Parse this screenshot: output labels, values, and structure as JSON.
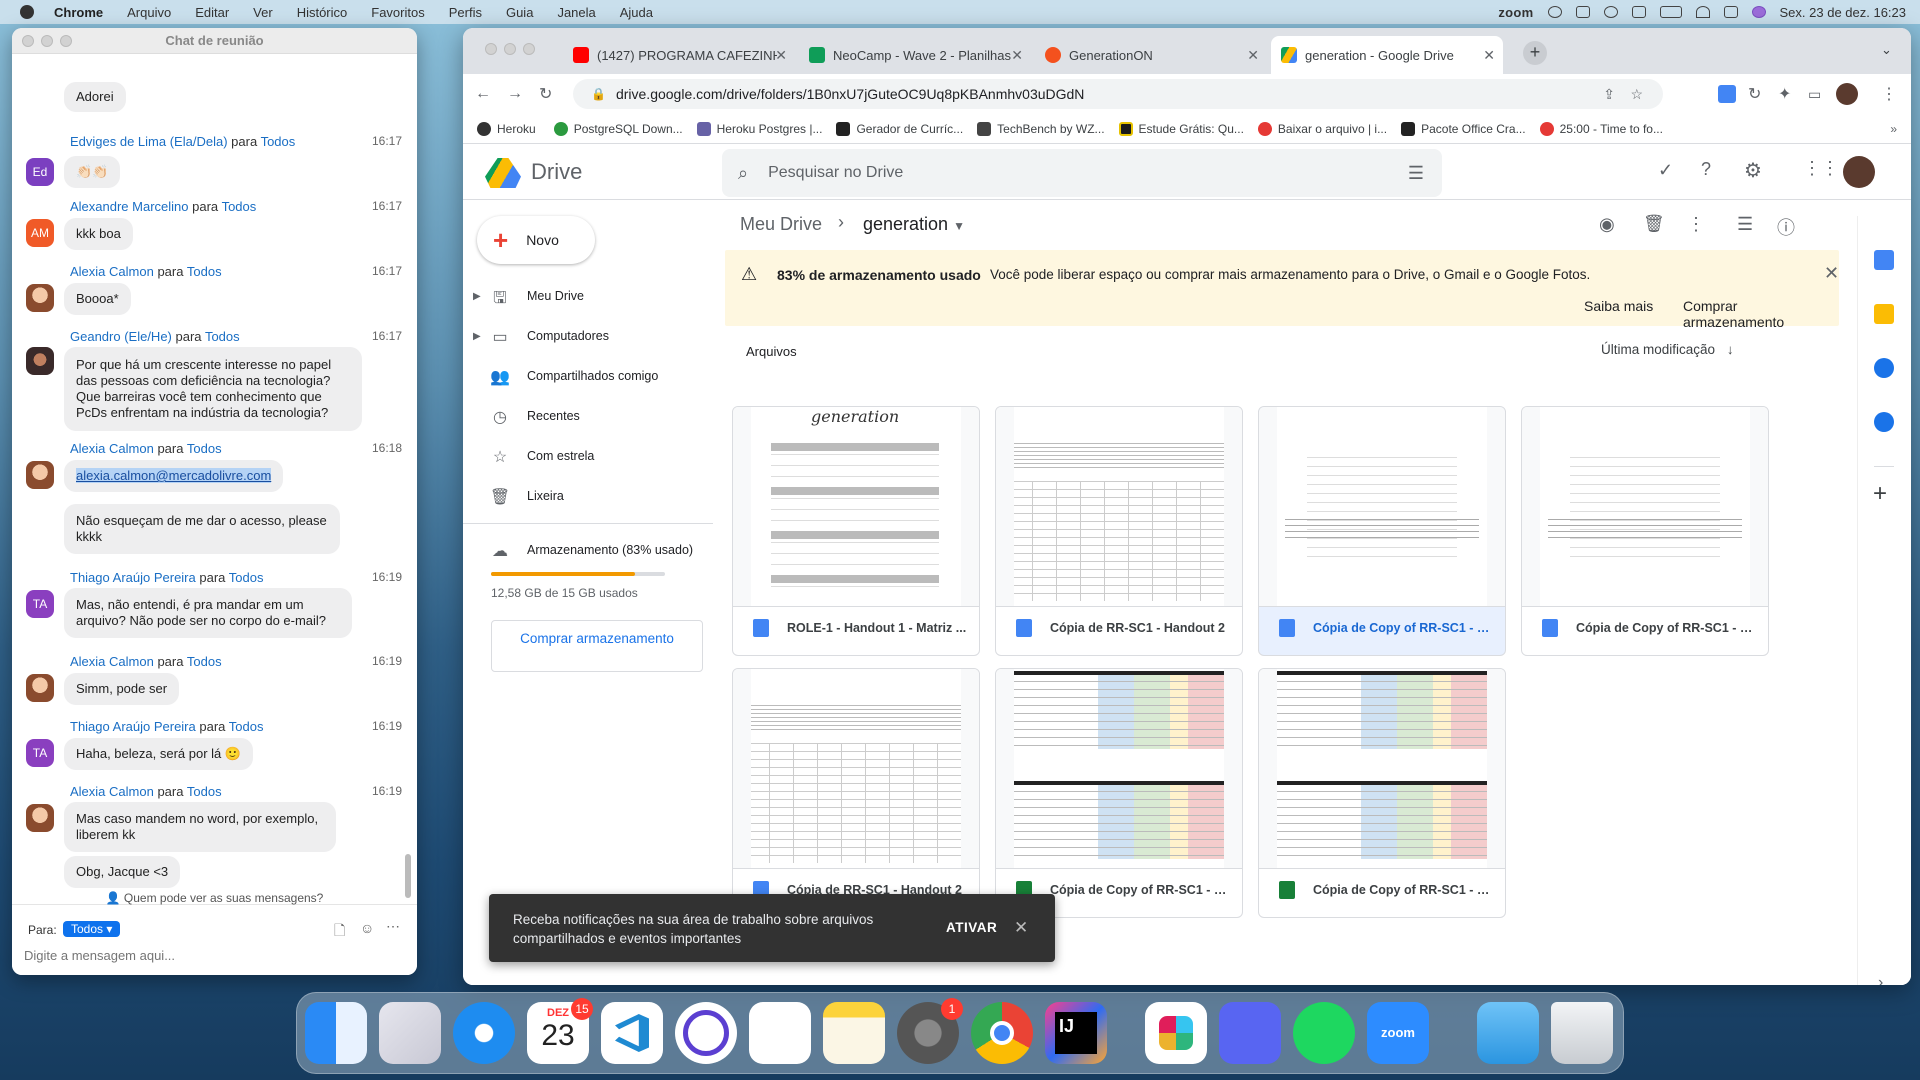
{
  "menubar": {
    "app": "Chrome",
    "items": [
      "Arquivo",
      "Editar",
      "Ver",
      "Histórico",
      "Favoritos",
      "Perfis",
      "Guia",
      "Janela",
      "Ajuda"
    ],
    "zoom_label": "zoom",
    "datetime": "Sex. 23 de dez.  16:23"
  },
  "chat": {
    "title": "Chat de reunião",
    "to_word": "para",
    "messages": [
      {
        "text": "Adorei"
      },
      {
        "sender": "Edviges de Lima (Ela/Dela)",
        "to": "Todos",
        "time": "16:17",
        "avatar": "Ed",
        "text": "👏🏻👏🏻"
      },
      {
        "sender": "Alexandre Marcelino",
        "to": "Todos",
        "time": "16:17",
        "avatar": "AM",
        "text": "kkk boa"
      },
      {
        "sender": "Alexia Calmon",
        "to": "Todos",
        "time": "16:17",
        "text": "Boooa*"
      },
      {
        "sender": "Geandro (Ele/He)",
        "to": "Todos",
        "time": "16:17",
        "text": "Por que há um crescente interesse no papel das pessoas com deficiência na tecnologia? Que barreiras você tem conhecimento que PcDs enfrentam na indústria da tecnologia?"
      },
      {
        "sender": "Alexia Calmon",
        "to": "Todos",
        "time": "16:18",
        "text": "alexia.calmon@mercadolivre.com"
      },
      {
        "text": "Não esqueçam de me dar o acesso, please kkkk"
      },
      {
        "sender": "Thiago Araújo Pereira",
        "to": "Todos",
        "time": "16:19",
        "avatar": "TA",
        "text": "Mas, não entendi, é pra mandar em um arquivo? Não pode ser no corpo do e-mail?"
      },
      {
        "sender": "Alexia Calmon",
        "to": "Todos",
        "time": "16:19",
        "text": "Simm, pode ser"
      },
      {
        "sender": "Thiago Araújo Pereira",
        "to": "Todos",
        "time": "16:19",
        "avatar": "TA",
        "text": "Haha, beleza, será por lá 🙂"
      },
      {
        "sender": "Alexia Calmon",
        "to": "Todos",
        "time": "16:19",
        "text": "Mas caso mandem no word, por exemplo, liberem kk"
      },
      {
        "text": "Obg, Jacque <3"
      }
    ],
    "who_can_see": "Quem pode ver as suas mensagens?",
    "to_label": "Para:",
    "to_value": "Todos",
    "input_placeholder": "Digite a mensagem aqui..."
  },
  "browser": {
    "tabs": [
      {
        "title": "(1427) PROGRAMA CAFEZINHO",
        "color": "#ff0000"
      },
      {
        "title": "NeoCamp - Wave 2 - Planilhas",
        "color": "#0f9d58"
      },
      {
        "title": "GenerationON",
        "color": "#f4511e"
      },
      {
        "title": "generation - Google Drive",
        "color": "#4285f4"
      }
    ],
    "url": "drive.google.com/drive/folders/1B0nxU7jGuteOC9Uq8pKBAnmhv03uDGdN",
    "bookmarks": [
      "Heroku",
      "PostgreSQL Down...",
      "Heroku Postgres |...",
      "Gerador de Curríc...",
      "TechBench by WZ...",
      "Estude Grátis: Qu...",
      "Baixar o arquivo | i...",
      "Pacote Office Cra...",
      "25:00 - Time to fo..."
    ]
  },
  "drive": {
    "logo": "Drive",
    "search_placeholder": "Pesquisar no Drive",
    "new_button": "Novo",
    "nav": [
      "Meu Drive",
      "Computadores",
      "Compartilhados comigo",
      "Recentes",
      "Com estrela",
      "Lixeira"
    ],
    "storage_label": "Armazenamento (83% usado)",
    "storage_used": "12,58 GB de 15 GB usados",
    "storage_fraction": 0.83,
    "buy_button": "Comprar armazenamento",
    "breadcrumb_root": "Meu Drive",
    "breadcrumb_current": "generation",
    "banner_bold": "83% de armazenamento usado",
    "banner_text": "Você pode liberar espaço ou comprar mais armazenamento para o Drive, o Gmail e o Google Fotos.",
    "banner_learn": "Saiba mais",
    "banner_buy": "Comprar armazenamento",
    "section": "Arquivos",
    "sort": "Última modificação",
    "files": [
      {
        "name": "ROLE-1 - Handout 1 - Matriz ...",
        "type": "doc",
        "thumb": "generation"
      },
      {
        "name": "Cópia de RR-SC1 - Handout 2",
        "type": "doc",
        "thumb": "table"
      },
      {
        "name": "Cópia de Copy of RR-SC1 - H...",
        "type": "doc",
        "thumb": "text",
        "selected": true
      },
      {
        "name": "Cópia de Copy of RR-SC1 - H...",
        "type": "doc",
        "thumb": "text"
      },
      {
        "name": "Cópia de RR-SC1 - Handout 2",
        "type": "doc",
        "thumb": "table"
      },
      {
        "name": "Cópia de Copy of RR-SC1 - H...",
        "type": "sheet",
        "thumb": "sheet"
      },
      {
        "name": "Cópia de Copy of RR-SC1 - H...",
        "type": "sheet",
        "thumb": "sheet"
      }
    ]
  },
  "toast": {
    "text": "Receba notificações na sua área de trabalho sobre arquivos compartilhados e eventos importantes",
    "action": "ATIVAR"
  },
  "dock": {
    "calendar_month": "DEZ",
    "calendar_day": "23",
    "calendar_badge": "15",
    "settings_badge": "1"
  }
}
